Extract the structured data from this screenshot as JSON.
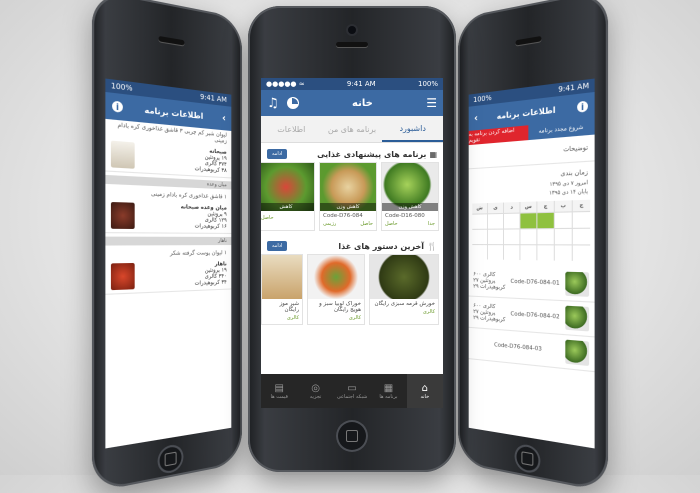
{
  "status": {
    "carrier": "●●●●● ≈",
    "time": "9:41 AM",
    "battery": "100%"
  },
  "center": {
    "title": "خانه",
    "tabs": [
      "داشبورد",
      "برنامه های من",
      "اطلاعات"
    ],
    "section1": {
      "title": "برنامه های پیشنهادی غذایی",
      "more": "ادامه",
      "cards": [
        {
          "caption": "کاهش وزن",
          "code": "Code-D16-080",
          "meta_left": "جدا",
          "meta_right": "حاصل"
        },
        {
          "caption": "کاهش وزن",
          "code": "Code-D76-084",
          "meta_left": "حاصل",
          "meta_right": "رژیمی"
        },
        {
          "caption": "کاهش",
          "code": "",
          "meta_left": "",
          "meta_right": "حاصل"
        }
      ]
    },
    "section2": {
      "title": "آخرین دستور های غذا",
      "more": "ادامه",
      "recipes": [
        {
          "name": "خورش قرمه سبزی رایگان",
          "meta": "کالری"
        },
        {
          "name": "خوراک لوبیا سبز و هویج رایگان",
          "meta": "کالری"
        },
        {
          "name": "شیر موز رایگان",
          "meta": "کالری"
        }
      ]
    },
    "tabbar": [
      "خانه",
      "برنامه ها",
      "شبکه اجتماعی",
      "تجزیه",
      "قیمت ها"
    ]
  },
  "left": {
    "title": "اطلاعات برنامه",
    "intro": "لیوان شیر کم چربی ۳ قاشق غذاخوری کره بادام زمینی",
    "items": [
      {
        "name": "صبحانه",
        "protein": "۱۹ پروتئین",
        "cal": "۳۷۴ کالری",
        "carb": "۳۸ کربوهیدرات",
        "fat": "۱۵ چربی"
      },
      {
        "name": "میان وعده صبحانه",
        "protein": "۹ پروتئین",
        "cal": "۱۲۹ کالری",
        "carb": "۱۶ کربوهیدرات",
        "fat": "۴ چربی"
      },
      {
        "name": "ناهار",
        "protein": "۱۹ پروتئین",
        "cal": "۳۴۰ کالری",
        "carb": "۳۴ کربوهیدرات",
        "fat": "۱۱ چربی"
      }
    ],
    "band1": "میان وعده",
    "band2": "ناهار",
    "sub1": "۱ قاشق غذاخوری کره بادام زمینی",
    "sub2": "۱ لیوان پوست گرفته شکر"
  },
  "right": {
    "title": "اطلاعات برنامه",
    "red_button": "اضافه کردن برنامه به تقویم",
    "right_button": "شروع مجدد برنامه",
    "desc_label": "توضیحات",
    "schedule_label": "زمان بندی",
    "range1": "امروز ۷ دی ۱۳۹۵",
    "range2": "پایان ۱۴ دی ۱۳۹۵",
    "weekdays": [
      "ش",
      "ی",
      "د",
      "س",
      "چ",
      "پ",
      "ج"
    ],
    "plans": [
      {
        "code": "Code-D76-084-01",
        "cal": "۶۰۰ کالری",
        "p": "۲۷ پروتئین",
        "c": "۲۹ کربوهیدرات"
      },
      {
        "code": "Code-D76-084-02",
        "cal": "۶۰۰ کالری",
        "p": "۲۷ پروتئین",
        "c": "۲۹ کربوهیدرات"
      },
      {
        "code": "Code-D76-084-03",
        "cal": "",
        "p": "",
        "c": ""
      }
    ]
  },
  "colors": {
    "nav": "#3c6aa3",
    "status": "#2b4f80",
    "accent_green": "#8fc13f",
    "red": "#e0252d"
  }
}
